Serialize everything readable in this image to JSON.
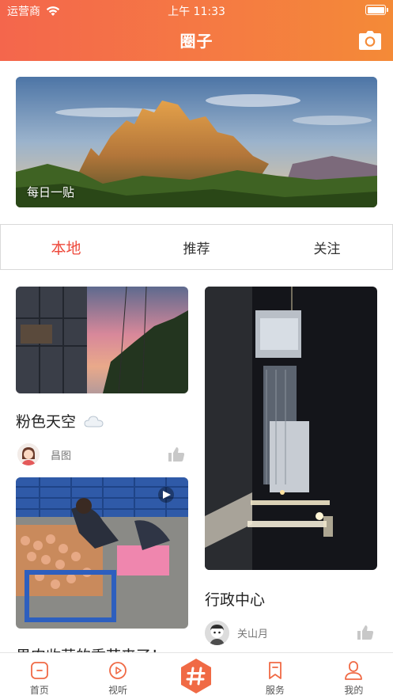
{
  "status_bar": {
    "carrier": "运营商",
    "time": "上午 11:33"
  },
  "header": {
    "title": "圈子",
    "camera_icon": "camera-icon"
  },
  "banner": {
    "label": "每日一贴"
  },
  "tabs": [
    {
      "label": "本地",
      "active": true
    },
    {
      "label": "推荐",
      "active": false
    },
    {
      "label": "关注",
      "active": false
    }
  ],
  "posts": [
    {
      "title": "粉色天空",
      "author": "昌图",
      "title_icon": "cloud-icon"
    },
    {
      "title": "行政中心",
      "author": "关山月"
    },
    {
      "title": "果肉收获的季节来了！",
      "author": ""
    }
  ],
  "tabbar": [
    {
      "label": "首页",
      "icon": "home-icon"
    },
    {
      "label": "视听",
      "icon": "play-icon"
    },
    {
      "label": "",
      "icon": "hashtag-icon"
    },
    {
      "label": "服务",
      "icon": "bookmark-icon"
    },
    {
      "label": "我的",
      "icon": "user-icon"
    }
  ],
  "colors": {
    "accent": "#f06a45",
    "active_tab": "#ee4a3c",
    "header_start": "#f4664c",
    "header_end": "#f48a37"
  }
}
